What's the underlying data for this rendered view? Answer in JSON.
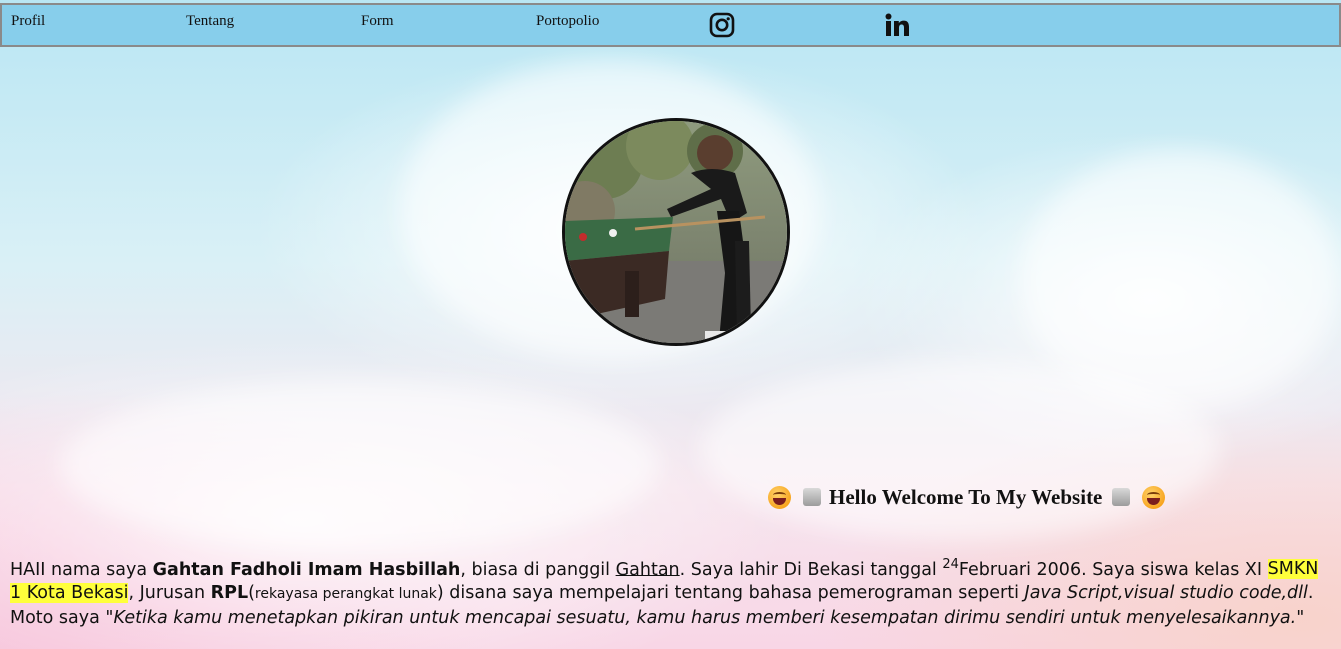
{
  "nav": {
    "links": [
      "Profil",
      "Tentang",
      "Form",
      "Portopolio"
    ],
    "icons": [
      "instagram-icon",
      "linkedin-icon"
    ]
  },
  "colors": {
    "navbar_bg": "#87ceeb",
    "navbar_border": "#8a8a8a",
    "highlight": "#ffff3b"
  },
  "welcome": {
    "text": "Hello Welcome To My Website"
  },
  "bio": {
    "t1": "HAII nama saya ",
    "name": "Gahtan Fadholi Imam Hasbillah",
    "t2": ", biasa di panggil ",
    "nickname": "Gahtan",
    "t3": ". Saya lahir Di Bekasi tanggal ",
    "birth_day": "24",
    "t4": "Februari 2006. Saya siswa kelas XI ",
    "school": "SMKN 1 Kota Bekasi",
    "t5": ", Jurusan ",
    "major": "RPL",
    "t6": "(",
    "major_full": "rekayasa perangkat lunak",
    "t7": ") disana saya mempelajari tentang bahasa pemerograman seperti ",
    "tools": "Java Script,visual studio code,dll",
    "t8": ". Moto saya ",
    "motto": "\"Ketika kamu menetapkan pikiran untuk mencapai sesuatu, kamu harus memberi kesempatan dirimu sendiri untuk menyelesaikannya.\""
  }
}
